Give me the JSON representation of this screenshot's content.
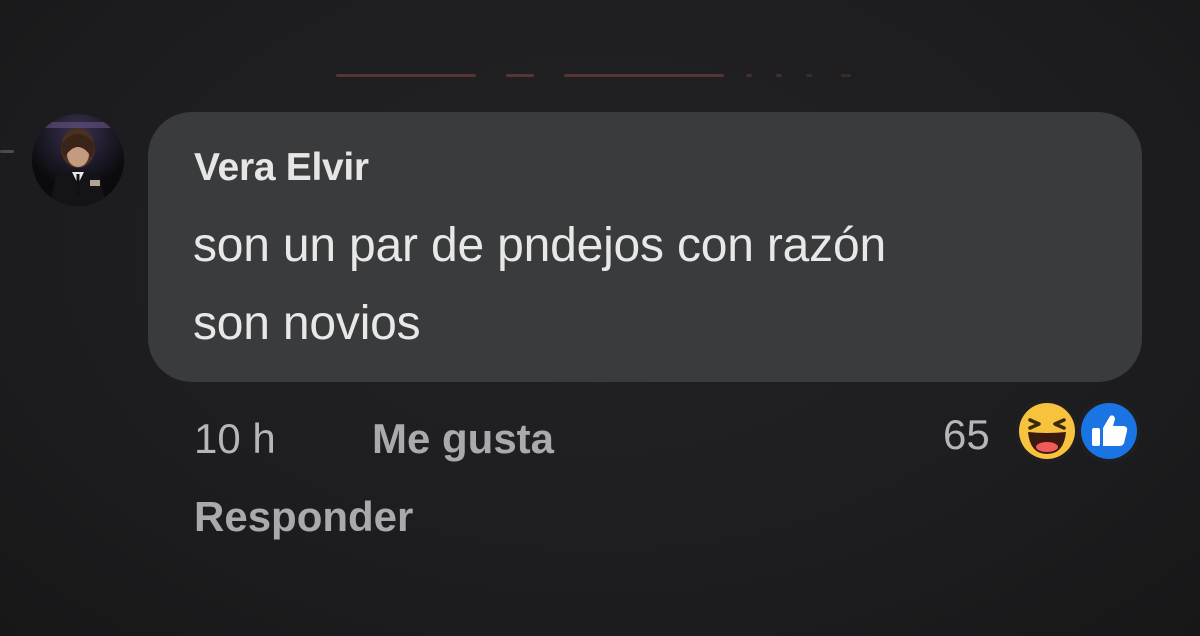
{
  "comment": {
    "author": "Vera Elvir",
    "text_line_1": "son un par de pndejos con razón",
    "text_line_2": "son novios",
    "timestamp": "10 h",
    "like_label": "Me gusta",
    "reply_label": "Responder",
    "reaction_count": "65",
    "reactions": [
      "haha-icon",
      "like-icon"
    ]
  },
  "colors": {
    "background": "#1f1f21",
    "bubble": "#3a3b3c",
    "text_primary": "#e8e8e8",
    "text_secondary": "#a9aaac",
    "haha_yellow": "#f7c33f",
    "like_blue": "#1b74e4"
  }
}
